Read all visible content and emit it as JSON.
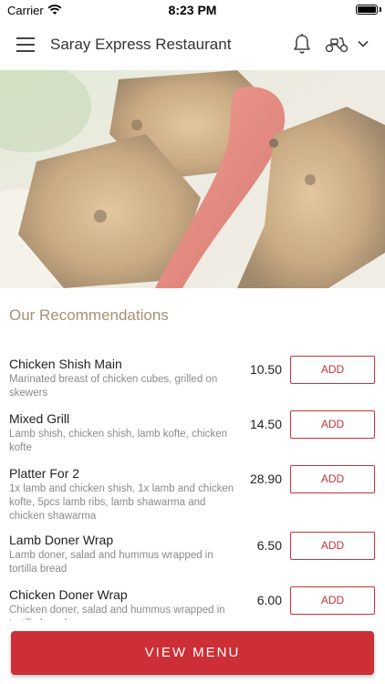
{
  "status_bar": {
    "carrier": "Carrier",
    "time": "8:23 PM"
  },
  "header": {
    "title": "Saray Express Restaurant",
    "icons": [
      "menu-icon",
      "bell-icon",
      "scooter-icon",
      "chevron-down-icon"
    ]
  },
  "hero": {
    "description": "food photo - grilled chicken shish with roasted pepper on rice"
  },
  "recommendations": {
    "title": "Our Recommendations",
    "items": [
      {
        "name": "Chicken Shish Main",
        "description": "Marinated breast of chicken cubes, grilled on skewers",
        "price": "10.50",
        "button": "ADD"
      },
      {
        "name": "Mixed Grill",
        "description": "Lamb shish, chicken shish, lamb kofte, chicken kofte",
        "price": "14.50",
        "button": "ADD"
      },
      {
        "name": "Platter For 2",
        "description": "1x lamb and chicken shish, 1x lamb and chicken kofte, 5pcs lamb ribs, lamb shawarma and chicken shawarma",
        "price": "28.90",
        "button": "ADD"
      },
      {
        "name": "Lamb Doner Wrap",
        "description": "Lamb doner, salad and hummus wrapped in tortilla bread",
        "price": "6.50",
        "button": "ADD"
      },
      {
        "name": "Chicken Doner Wrap",
        "description": "Chicken doner, salad and hummus wrapped in tortilla bread",
        "price": "6.00",
        "button": "ADD"
      }
    ]
  },
  "footer": {
    "button": "VIEW MENU"
  },
  "colors": {
    "accent": "#cc2f35",
    "section_title": "#a89072",
    "description": "#8a8a8a"
  }
}
